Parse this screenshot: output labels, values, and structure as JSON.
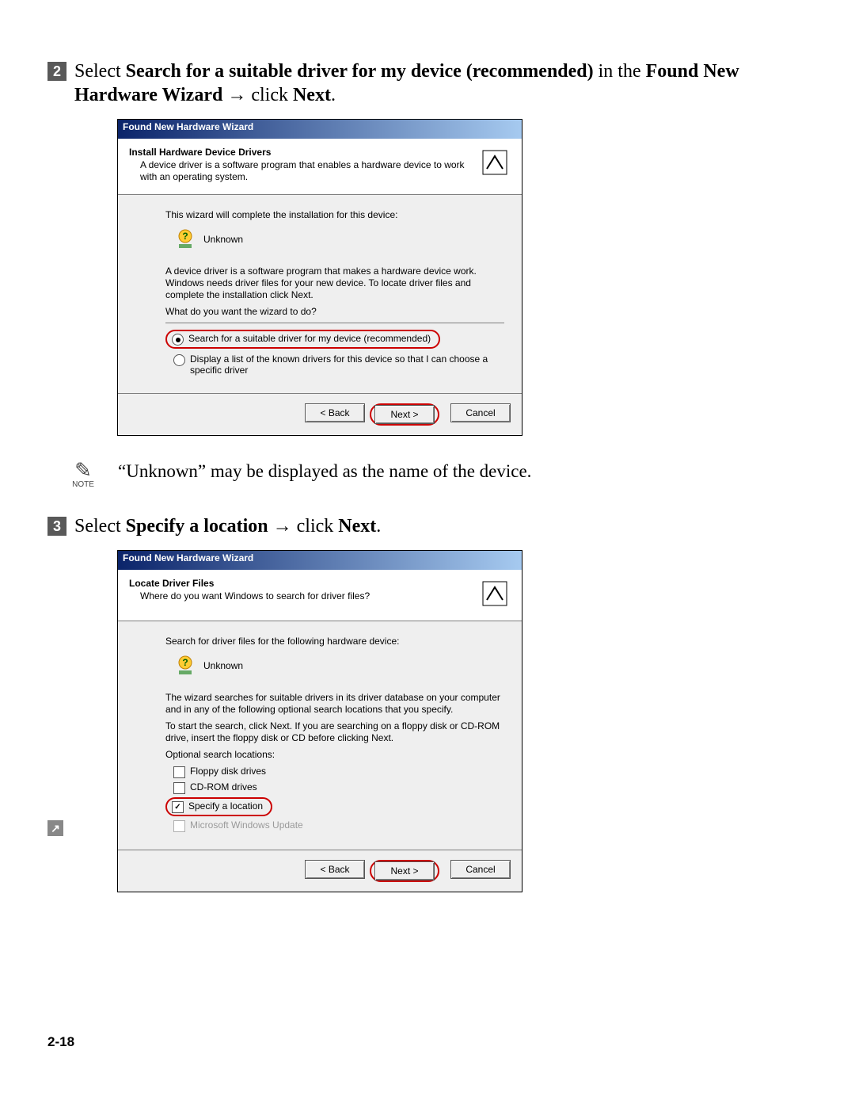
{
  "step2": {
    "number": "2",
    "pre": "Select ",
    "bold1": "Search for a suitable driver for my device (recommended)",
    "mid1": " in the ",
    "bold2": "Found New Hardware Wizard",
    "arrow": " → ",
    "mid2": "click ",
    "bold3": "Next",
    "end": "."
  },
  "dialog1": {
    "title": "Found New Hardware Wizard",
    "header_title": "Install Hardware Device Drivers",
    "header_sub": "A device driver is a software program that enables a hardware device to work with an operating system.",
    "line1": "This wizard will complete the installation for this device:",
    "device_name": "Unknown",
    "line2": "A device driver is a software program that makes a hardware device work. Windows needs driver files for your new device. To locate driver files and complete the installation click Next.",
    "prompt": "What do you want the wizard to do?",
    "radio1": "Search for a suitable driver for my device (recommended)",
    "radio2": "Display a list of the known drivers for this device so that I can choose a specific driver",
    "btn_back": "< Back",
    "btn_next": "Next >",
    "btn_cancel": "Cancel"
  },
  "note": {
    "label": "NOTE",
    "text": "“Unknown” may be displayed as the name of the device."
  },
  "step3": {
    "number": "3",
    "pre": "Select ",
    "bold1": "Specify a location",
    "arrow": " → ",
    "mid": "click ",
    "bold2": "Next",
    "end": "."
  },
  "dialog2": {
    "title": "Found New Hardware Wizard",
    "header_title": "Locate Driver Files",
    "header_sub": "Where do you want Windows to search for driver files?",
    "line1": "Search for driver files for the following hardware device:",
    "device_name": "Unknown",
    "line2": "The wizard searches for suitable drivers in its driver database on your computer and in any of the following optional search locations that you specify.",
    "line3": "To start the search, click Next. If you are searching on a floppy disk or CD-ROM drive, insert the floppy disk or CD before clicking Next.",
    "opt_label": "Optional search locations:",
    "chk1": "Floppy disk drives",
    "chk2": "CD-ROM drives",
    "chk3": "Specify a location",
    "chk4": "Microsoft Windows Update",
    "btn_back": "< Back",
    "btn_next": "Next >",
    "btn_cancel": "Cancel"
  },
  "page_number": "2-18"
}
